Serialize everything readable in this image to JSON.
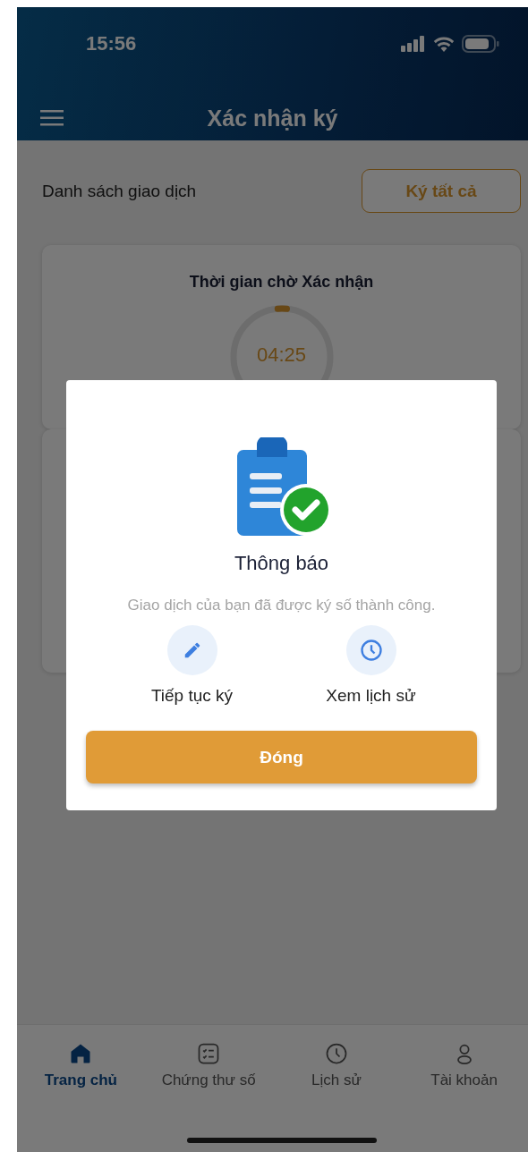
{
  "status_bar": {
    "time": "15:56"
  },
  "header": {
    "title": "Xác nhận ký"
  },
  "list_header": {
    "title": "Danh sách giao dịch",
    "action": "Ký tất cả"
  },
  "timer_card": {
    "title": "Thời gian chờ Xác nhận",
    "time": "04:25",
    "level": 0.03
  },
  "dialog": {
    "title": "Thông báo",
    "message": "Giao dịch của bạn đã được ký số thành công.",
    "actions": [
      {
        "kind": "edit",
        "label": "Tiếp tục ký"
      },
      {
        "kind": "history",
        "label": "Xem lịch sử"
      }
    ],
    "button": "Đóng"
  },
  "tabs": [
    {
      "kind": "home",
      "label": "Trang chủ",
      "selected": true
    },
    {
      "kind": "certificate",
      "label": "Chứng thư số",
      "selected": false
    },
    {
      "kind": "history",
      "label": "Lịch sử",
      "selected": false
    },
    {
      "kind": "account",
      "label": "Tài khoản",
      "selected": false
    }
  ]
}
